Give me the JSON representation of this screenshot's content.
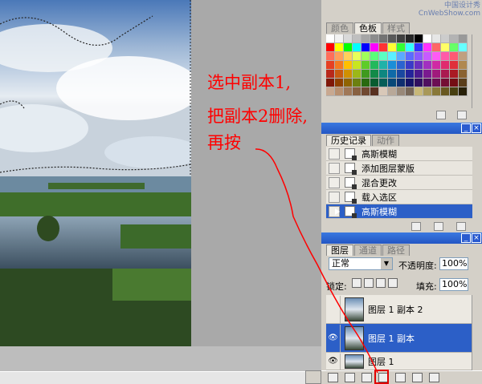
{
  "watermark": {
    "line1": "中国设计秀",
    "line2": "CnWebShow.com"
  },
  "annotations": {
    "line1": "选中副本1,",
    "line2": "把副本2删除,",
    "line3": "再按"
  },
  "swatches_panel": {
    "tabs": [
      "颜色",
      "色板",
      "样式"
    ],
    "active_tab": "色板",
    "colors": [
      "#ffffff",
      "#f2f2f2",
      "#d9d9d9",
      "#bfbfbf",
      "#a6a6a6",
      "#8c8c8c",
      "#737373",
      "#595959",
      "#404040",
      "#262626",
      "#000000",
      "#ffffff",
      "#e6e6e6",
      "#cccccc",
      "#b3b3b3",
      "#999999",
      "#ff0000",
      "#ffff00",
      "#00ff00",
      "#00ffff",
      "#0000ff",
      "#ff00ff",
      "#ff3333",
      "#ffff33",
      "#33ff33",
      "#33ffff",
      "#3333ff",
      "#ff33ff",
      "#ff6666",
      "#ffff66",
      "#66ff66",
      "#66ffff",
      "#ff6e5a",
      "#ff9e5a",
      "#ffcf5a",
      "#e6ff5a",
      "#9fff5a",
      "#5aff79",
      "#5affc2",
      "#5af0ff",
      "#5aaaff",
      "#5a6bff",
      "#8a5aff",
      "#c75aff",
      "#ff5af5",
      "#ff5aa8",
      "#ff5a73",
      "#c0a080",
      "#e64022",
      "#f47a20",
      "#ffc000",
      "#c8e620",
      "#5ecc28",
      "#22b95c",
      "#1fb2a8",
      "#1a8ed8",
      "#2b63d0",
      "#3a3ac8",
      "#6a2fc0",
      "#a22fc0",
      "#d02aa4",
      "#e02a6e",
      "#e0303a",
      "#b08850",
      "#b8281a",
      "#c85a10",
      "#d09000",
      "#9cb818",
      "#3f9a1e",
      "#128a48",
      "#0d8780",
      "#0f6aa8",
      "#1a48a0",
      "#24249a",
      "#4a1a90",
      "#7a1a90",
      "#a01a7c",
      "#aa1a50",
      "#aa1a24",
      "#8a6230",
      "#801808",
      "#904000",
      "#906400",
      "#6c8010",
      "#286a10",
      "#085c30",
      "#065e58",
      "#084878",
      "#0e2e70",
      "#141468",
      "#301060",
      "#501060",
      "#6c0e54",
      "#740e34",
      "#740e14",
      "#5a3e1a",
      "#c8a890",
      "#b89070",
      "#a07858",
      "#886040",
      "#704830",
      "#583020",
      "#d8c8b8",
      "#b8a898",
      "#988878",
      "#786858",
      "#c8b878",
      "#a89858",
      "#887838",
      "#685820",
      "#484010",
      "#282008"
    ]
  },
  "history_panel": {
    "tabs": [
      "历史记录",
      "动作"
    ],
    "active_tab": "历史记录",
    "items": [
      {
        "label": "高斯模糊",
        "active": false
      },
      {
        "label": "添加图层蒙版",
        "active": false
      },
      {
        "label": "混合更改",
        "active": false
      },
      {
        "label": "载入选区",
        "active": false
      },
      {
        "label": "高斯模糊",
        "active": true
      }
    ]
  },
  "layers_panel": {
    "tabs": [
      "图层",
      "通道",
      "路径"
    ],
    "active_tab": "图层",
    "blend_mode": "正常",
    "opacity_label": "不透明度:",
    "opacity_value": "100%",
    "lock_label": "锁定:",
    "fill_label": "填充:",
    "fill_value": "100%",
    "layers": [
      {
        "name": "图层 1 副本 2",
        "visible": false,
        "active": false
      },
      {
        "name": "图层 1 副本",
        "visible": true,
        "active": true
      },
      {
        "name": "图层 1",
        "visible": true,
        "active": false
      }
    ],
    "eye_glyph": "👁"
  },
  "colors": {
    "annotation": "#ff0000",
    "selection": "#2c5fc7",
    "titlebar": "#2356c4"
  }
}
